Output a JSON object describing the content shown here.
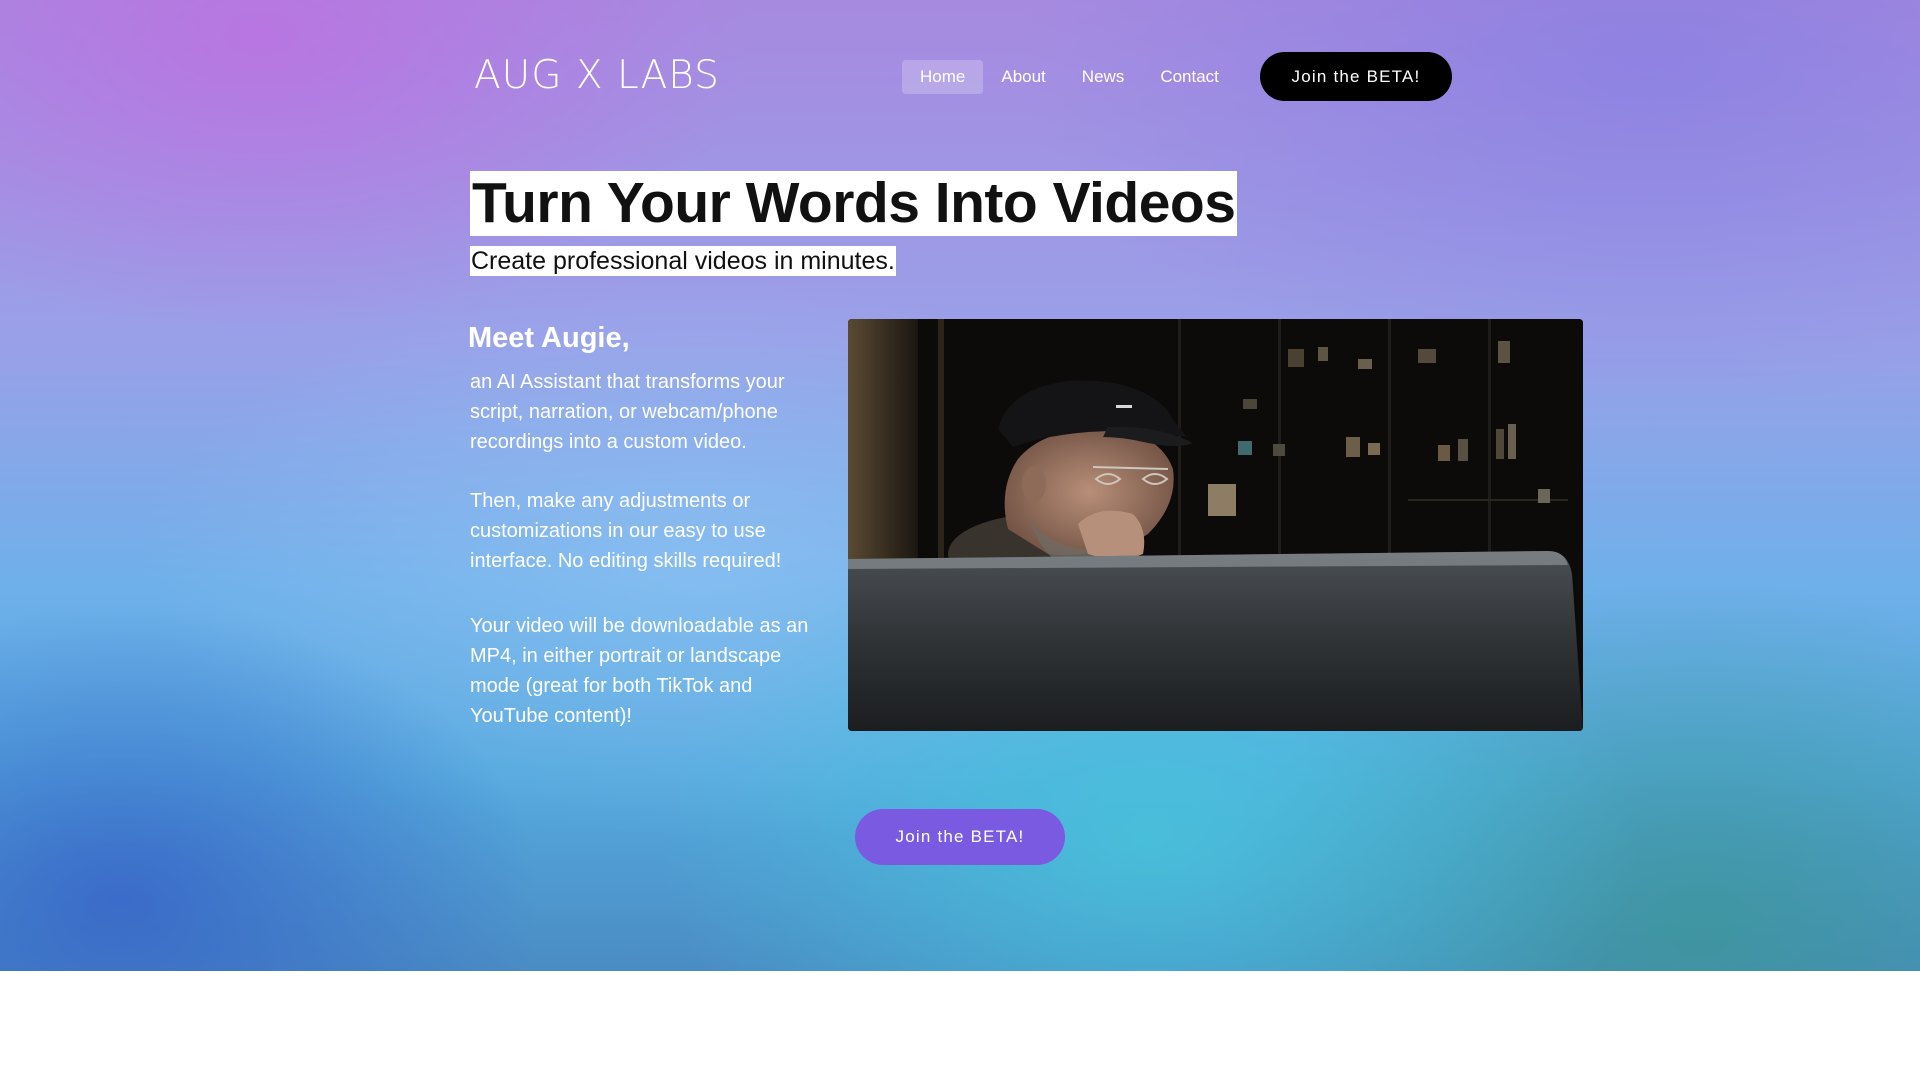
{
  "brand": {
    "logo_text": "AUG X LABS"
  },
  "nav": {
    "items": [
      {
        "label": "Home",
        "active": true
      },
      {
        "label": "About",
        "active": false
      },
      {
        "label": "News",
        "active": false
      },
      {
        "label": "Contact",
        "active": false
      }
    ],
    "cta_label": "Join the BETA!"
  },
  "hero": {
    "headline": "Turn Your Words Into Videos",
    "subheadline": "Create professional videos in minutes."
  },
  "intro": {
    "title": "Meet Augie,",
    "paragraphs": [
      "an AI Assistant that transforms your script, narration, or webcam/phone recordings into a custom video.",
      "Then, make any adjustments or customizations in our easy to use interface. No editing skills required!",
      "Your video will be downloadable as an MP4, in either portrait or landscape mode (great for both TikTok and YouTube content)!"
    ]
  },
  "media": {
    "video_subject": "man-in-cap-at-laptop"
  },
  "cta_bottom": {
    "label": "Join the BETA!"
  },
  "colors": {
    "primary_button": "#000000",
    "secondary_button": "#7a5ae0",
    "headline_highlight": "#ffffff",
    "text_on_gradient": "#ffffff"
  }
}
